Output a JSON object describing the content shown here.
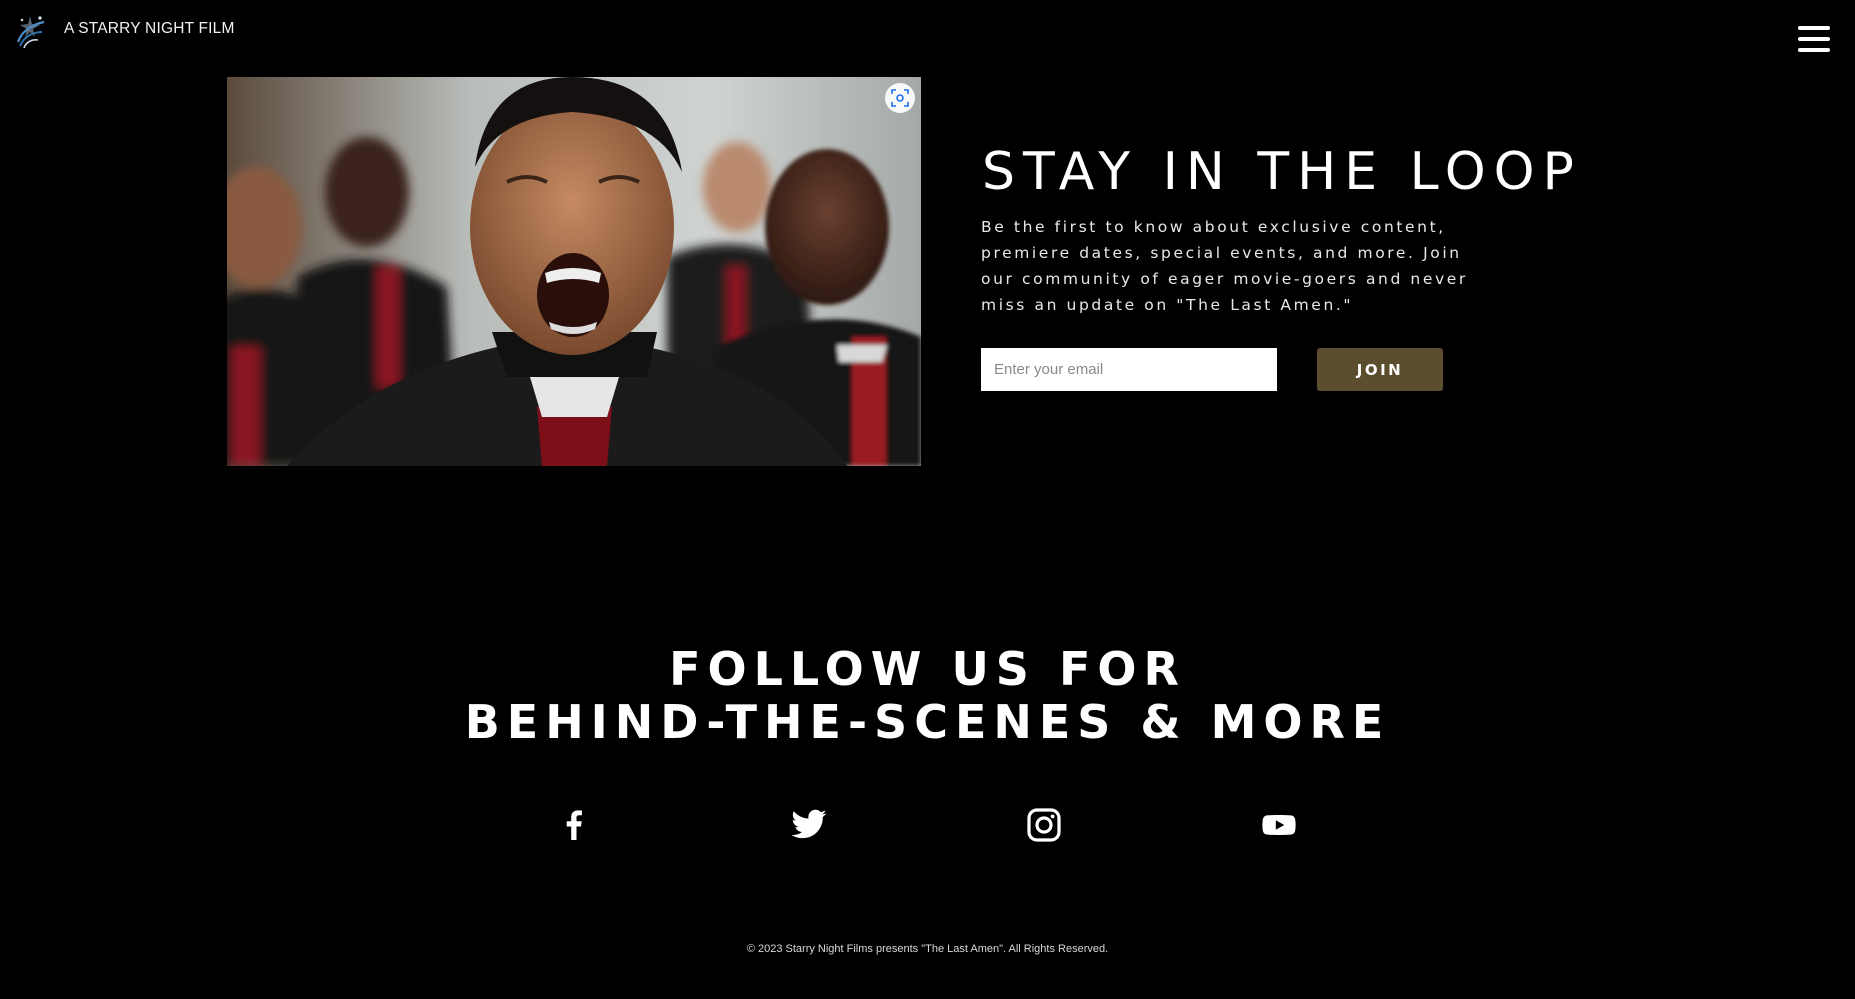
{
  "header": {
    "brand": "A STARRY NIGHT FILM",
    "logo_icon": "starry-night-logo",
    "menu_icon": "hamburger-menu-icon"
  },
  "hero": {
    "image_alt": "Choir of priests singing",
    "lens_icon": "visual-search-icon"
  },
  "newsletter": {
    "title": "STAY IN THE LOOP",
    "description": "Be the first to know about exclusive content, premiere dates, special events, and more. Join our community of eager movie-goers and never miss an update on \"The Last Amen.\"",
    "email_placeholder": "Enter your email",
    "join_label": "JOIN",
    "accent_color": "#5b4e2e"
  },
  "follow": {
    "line1": "FOLLOW US FOR",
    "line2": "BEHIND-THE-SCENES & MORE",
    "socials": [
      {
        "name": "facebook",
        "icon": "facebook-icon"
      },
      {
        "name": "twitter",
        "icon": "twitter-icon"
      },
      {
        "name": "instagram",
        "icon": "instagram-icon"
      },
      {
        "name": "youtube",
        "icon": "youtube-icon"
      }
    ]
  },
  "footer": {
    "copyright": "© 2023 Starry Night Films presents \"The Last Amen\". All Rights Reserved."
  }
}
